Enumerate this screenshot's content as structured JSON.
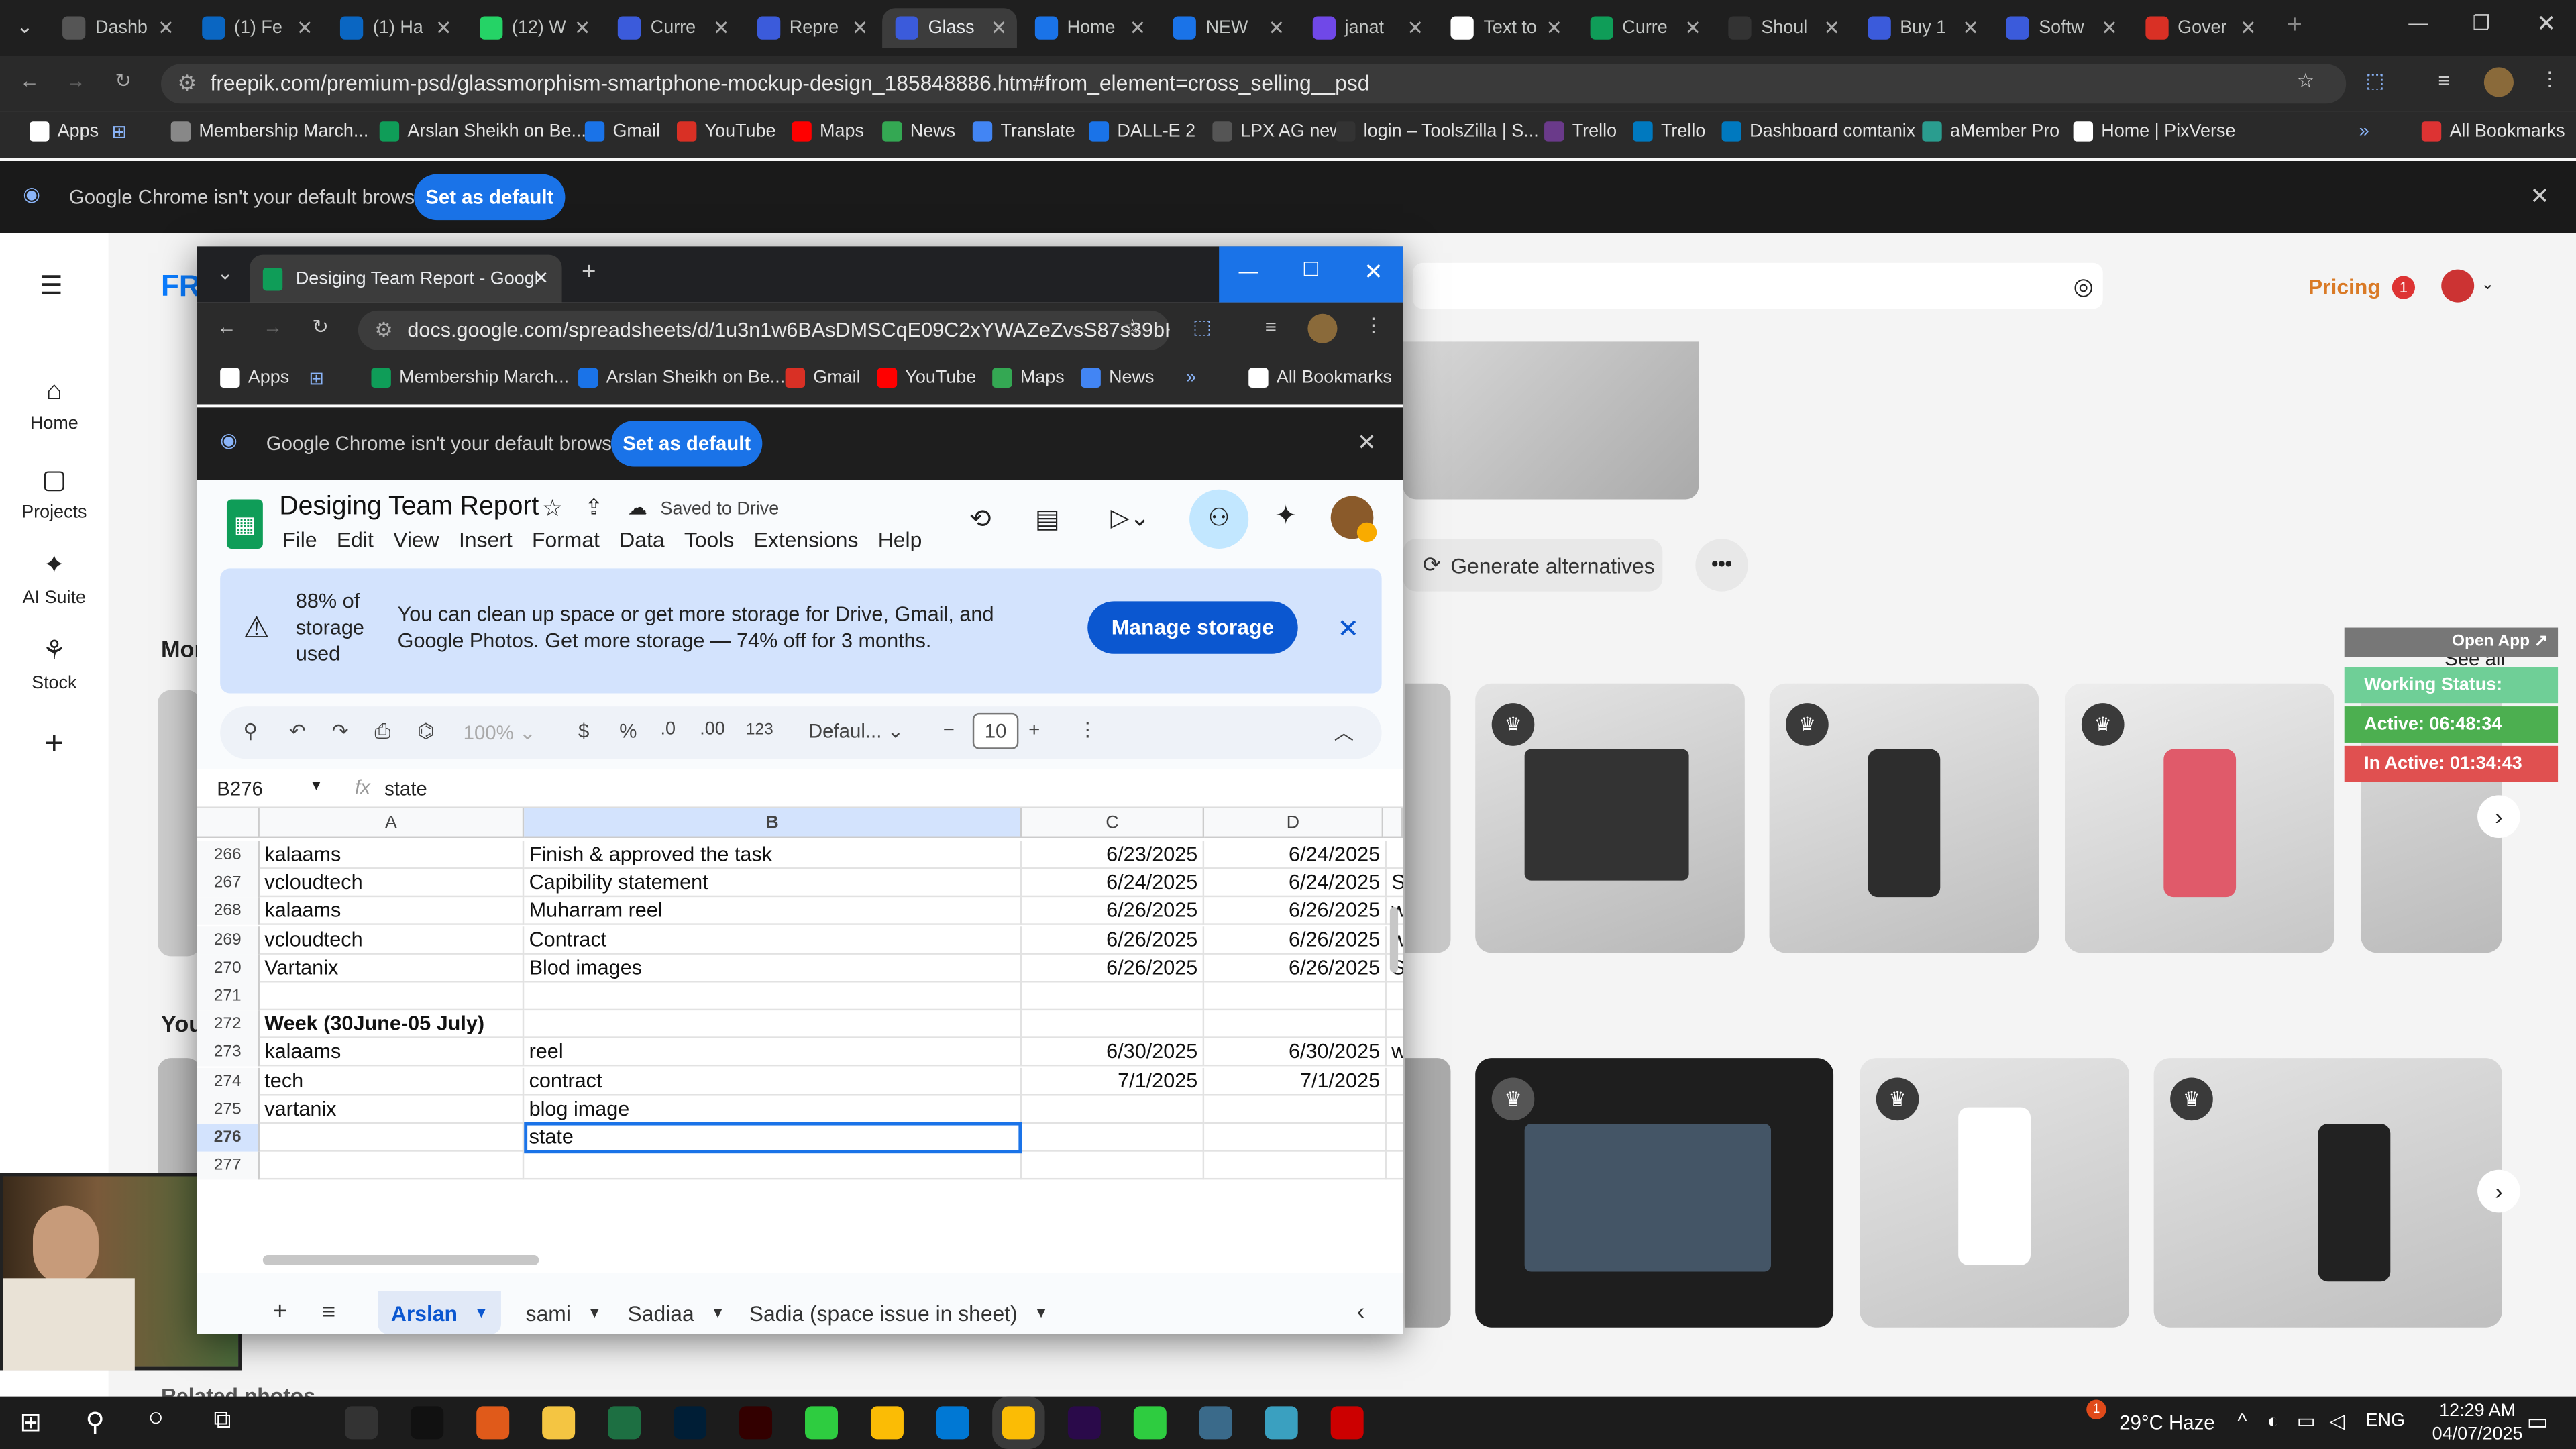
{
  "outer_tabs": [
    "Dashb",
    "(1) Fe",
    "(1) Ha",
    "(12) W",
    "Curre",
    "Repre",
    "Glass",
    "Home",
    "NEW",
    "janat",
    "Text to",
    "Curre",
    "Shoul",
    "Buy 1",
    "Softw",
    "Gover"
  ],
  "outer_url": "freepik.com/premium-psd/glassmorphism-smartphone-mockup-design_185848886.htm#from_element=cross_selling__psd",
  "bookmarks": [
    "Apps",
    "Membership March...",
    "Arslan Sheikh on Be...",
    "Gmail",
    "YouTube",
    "Maps",
    "News",
    "Translate",
    "DALL-E 2",
    "LPX AG new",
    "login – ToolsZilla | S...",
    "Trello",
    "Trello",
    "Dashboard comtanix",
    "aMember Pro",
    "Home | PixVerse",
    "All Bookmarks"
  ],
  "default_msg": "Google Chrome isn't your default browser",
  "set_default": "Set as default",
  "freepik": {
    "logo": "FR",
    "sidebar": [
      "Home",
      "Projects",
      "AI Suite",
      "Stock"
    ],
    "pricing": "Pricing",
    "badge": "1",
    "generate": "Generate alternatives",
    "section_more": "Mor",
    "section_you": "You",
    "see_all": "See all",
    "related": "Related photos"
  },
  "work_panel": {
    "open_app": "Open App ↗",
    "working": "Working Status: Active",
    "active": "Active: 06:48:34",
    "inactive": "In Active: 01:34:43"
  },
  "sheet_window": {
    "tab_title": "Desiging Team Report - Googl",
    "url": "docs.google.com/spreadsheets/d/1u3n1w6BAsDMSCqE09C2xYWAZeZvsS87s39bH...",
    "bookmarks": [
      "Apps",
      "Membership March...",
      "Arslan Sheikh on Be...",
      "Gmail",
      "YouTube",
      "Maps",
      "News",
      "All Bookmarks"
    ],
    "doc_title": "Desiging Team Report",
    "saved": "Saved to Drive",
    "menu": [
      "File",
      "Edit",
      "View",
      "Insert",
      "Format",
      "Data",
      "Tools",
      "Extensions",
      "Help"
    ],
    "storage_pct": "88% of storage used",
    "storage_msg": "You can clean up space or get more storage for Drive, Gmail, and Google Photos. Get more storage — 74% off for 3 months.",
    "manage": "Manage storage",
    "zoom": "100%",
    "fmt_currency": "$",
    "fmt_percent": "%",
    "fmt_dec_less": ".0",
    "fmt_dec_more": ".00",
    "fmt_123": "123",
    "font": "Defaul...",
    "font_size": "10",
    "name_box": "B276",
    "formula": "state",
    "columns": [
      "A",
      "B",
      "C",
      "D"
    ],
    "rows": [
      {
        "n": "266",
        "a": "kalaams",
        "b": "Finish & approved the task",
        "c": "6/23/2025",
        "d": "6/24/2025"
      },
      {
        "n": "267",
        "a": "vcloudtech",
        "b": "Capibility statement",
        "c": "6/24/2025",
        "d": "6/24/2025",
        "e": "S"
      },
      {
        "n": "268",
        "a": "kalaams",
        "b": "Muharram reel",
        "c": "6/26/2025",
        "d": "6/26/2025",
        "e": "w"
      },
      {
        "n": "269",
        "a": "vcloudtech",
        "b": "Contract",
        "c": "6/26/2025",
        "d": "6/26/2025",
        "e": "w"
      },
      {
        "n": "270",
        "a": "Vartanix",
        "b": "Blod images",
        "c": "6/26/2025",
        "d": "6/26/2025",
        "e": "S"
      },
      {
        "n": "271"
      },
      {
        "n": "272",
        "a": "Week (30June-05 July)"
      },
      {
        "n": "273",
        "a": "kalaams",
        "b": "reel",
        "c": "6/30/2025",
        "d": "6/30/2025",
        "e": "w"
      },
      {
        "n": "274",
        "a": "tech",
        "b": "contract",
        "c": "7/1/2025",
        "d": "7/1/2025"
      },
      {
        "n": "275",
        "a": "vartanix",
        "b": "blog image"
      },
      {
        "n": "276",
        "b": "state"
      },
      {
        "n": "277"
      }
    ],
    "sheet_tabs": [
      "Arslan",
      "sami",
      "Sadiaa",
      "Sadia (space issue in sheet)"
    ]
  },
  "taskbar": {
    "weather": "29°C Haze",
    "weather_badge": "1",
    "lang": "ENG",
    "time": "12:29 AM",
    "date": "04/07/2025"
  }
}
